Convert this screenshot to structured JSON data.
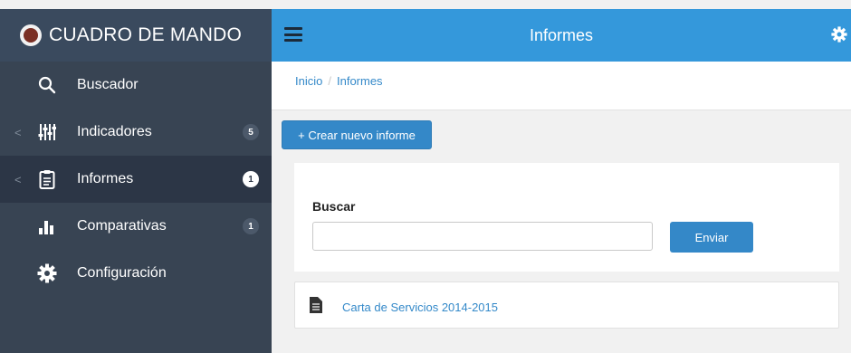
{
  "app": {
    "brand": "CUADRO DE MANDO"
  },
  "sidebar": {
    "items": [
      {
        "label": "Buscador",
        "icon": "search-icon",
        "badge": "",
        "active": false
      },
      {
        "label": "Indicadores",
        "icon": "sliders-icon",
        "badge": "5",
        "active": false
      },
      {
        "label": "Informes",
        "icon": "clipboard-icon",
        "badge": "1",
        "active": true
      },
      {
        "label": "Comparativas",
        "icon": "bar-chart-icon",
        "badge": "1",
        "active": false
      },
      {
        "label": "Configuración",
        "icon": "gear-icon",
        "badge": "",
        "active": false
      }
    ]
  },
  "topbar": {
    "title": "Informes"
  },
  "breadcrumb": {
    "home": "Inicio",
    "separator": "/",
    "current": "Informes"
  },
  "actions": {
    "create_label": "+ Crear nuevo informe"
  },
  "search": {
    "label": "Buscar",
    "value": "",
    "submit_label": "Enviar"
  },
  "reports": [
    {
      "title": "Carta de Servicios 2014-2015",
      "icon": "document-icon"
    }
  ],
  "colors": {
    "sidebar": "#384453",
    "sidebar_active": "#2c3646",
    "topbar": "#3498db",
    "button": "#3488c8",
    "link": "#3489c9"
  }
}
